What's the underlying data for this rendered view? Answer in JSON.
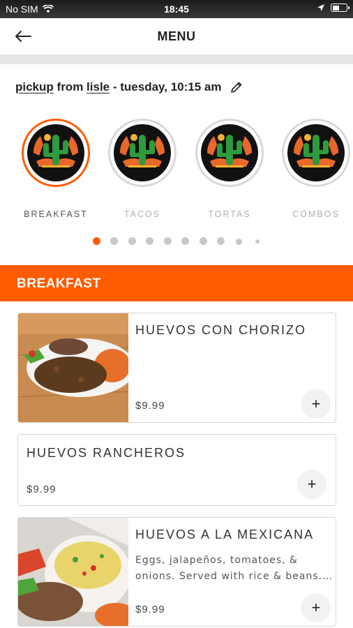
{
  "status_bar": {
    "carrier": "No SIM",
    "time": "18:45",
    "icons": [
      "wifi-icon",
      "location-arrow-icon",
      "battery-icon"
    ]
  },
  "header": {
    "back_icon": "arrow-left-icon",
    "title": "MENU"
  },
  "order_info": {
    "mode": "pickup",
    "from_word": "from",
    "location": "lisle",
    "time_text": "- tuesday, 10:15 am",
    "edit_icon": "pencil-icon"
  },
  "categories": [
    {
      "label": "BREAKFAST",
      "active": true,
      "icon": "cactus-logo-icon"
    },
    {
      "label": "TACOS",
      "active": false,
      "icon": "cactus-logo-icon"
    },
    {
      "label": "TORTAS",
      "active": false,
      "icon": "cactus-logo-icon"
    },
    {
      "label": "COMBOS",
      "active": false,
      "icon": "cactus-logo-icon"
    }
  ],
  "pagination": {
    "total_dots": 10,
    "active_index": 0
  },
  "section": {
    "title": "BREAKFAST"
  },
  "menu_items": [
    {
      "name": "HUEVOS CON CHORIZO",
      "description": "",
      "price": "$9.99",
      "has_image": true,
      "add_label": "+"
    },
    {
      "name": "HUEVOS RANCHEROS",
      "description": "",
      "price": "$9.99",
      "has_image": false,
      "add_label": "+"
    },
    {
      "name": "HUEVOS A LA MEXICANA",
      "description": "Eggs, jalapeños, tomatoes, & onions. Served with rice & beans.…",
      "price": "$9.99",
      "has_image": true,
      "add_label": "+"
    }
  ],
  "colors": {
    "accent": "#ff5c00",
    "inactive_ring": "#d8d8d8",
    "banner_text": "#ffffff"
  }
}
